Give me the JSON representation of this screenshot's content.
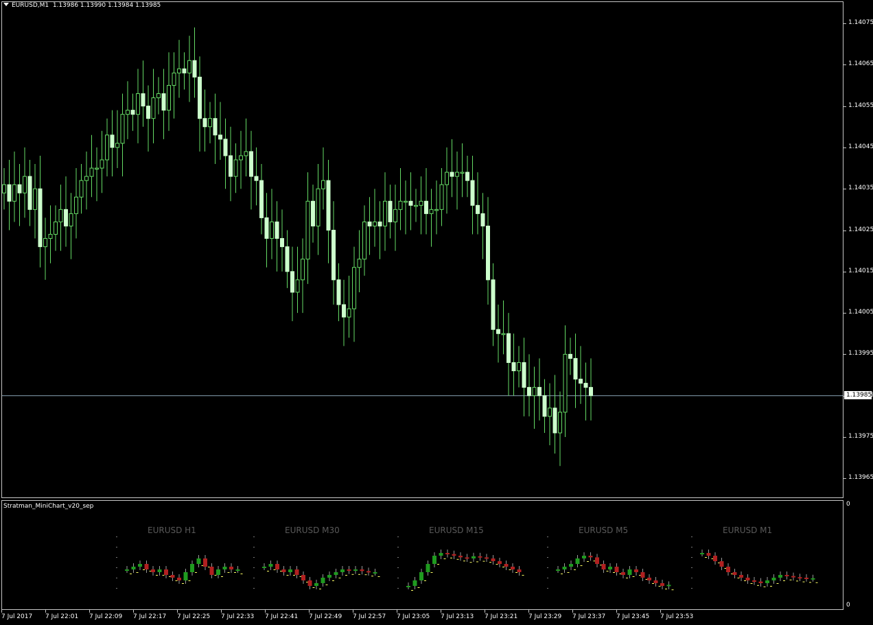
{
  "header": {
    "symbol_line": "EURUSD,M1  1.13986 1.13990 1.13984 1.13985"
  },
  "price_axis": {
    "labels": [
      "1.14075",
      "1.14065",
      "1.14055",
      "1.14045",
      "1.14035",
      "1.14025",
      "1.14015",
      "1.14005",
      "1.13995",
      "1.13985",
      "1.13975",
      "1.13965"
    ],
    "current": "1.13985"
  },
  "indicator": {
    "name": "Stratman_MiniChart_v20_sep",
    "scale_top": "0",
    "scale_bottom": "0",
    "mini_charts": [
      "EURUSD H1",
      "EURUSD M30",
      "EURUSD M15",
      "EURUSD M5",
      "EURUSD M1"
    ]
  },
  "time_axis": {
    "labels": [
      "7 Jul 2017",
      "7 Jul 22:01",
      "7 Jul 22:09",
      "7 Jul 22:17",
      "7 Jul 22:25",
      "7 Jul 22:33",
      "7 Jul 22:41",
      "7 Jul 22:49",
      "7 Jul 22:57",
      "7 Jul 23:05",
      "7 Jul 23:13",
      "7 Jul 23:21",
      "7 Jul 23:29",
      "7 Jul 23:37",
      "7 Jul 23:45",
      "7 Jul 23:53"
    ]
  },
  "colors": {
    "bull": "#000000",
    "bear": "#ccffcc",
    "wick": "#66dd66",
    "mini_bull": "#1f9a1f",
    "mini_bear": "#b02020",
    "price_line": "#8ba6b8"
  },
  "chart_data": {
    "type": "candlestick",
    "symbol": "EURUSD",
    "timeframe": "M1",
    "ylim": [
      1.1396,
      1.1408
    ],
    "current_price": 1.13985,
    "closes": [
      1.14036,
      1.14032,
      1.14036,
      1.14034,
      1.14038,
      1.1403,
      1.14035,
      1.14021,
      1.14023,
      1.14024,
      1.14027,
      1.1403,
      1.14026,
      1.14029,
      1.14033,
      1.14037,
      1.14038,
      1.1404,
      1.1404,
      1.14042,
      1.14048,
      1.14045,
      1.14046,
      1.14053,
      1.14054,
      1.14053,
      1.14058,
      1.14055,
      1.14052,
      1.14057,
      1.14058,
      1.14054,
      1.1406,
      1.14063,
      1.14064,
      1.14063,
      1.14066,
      1.14062,
      1.14052,
      1.1405,
      1.14052,
      1.14048,
      1.14047,
      1.14043,
      1.14038,
      1.14042,
      1.14043,
      1.14044,
      1.14038,
      1.14037,
      1.14028,
      1.14023,
      1.14027,
      1.14023,
      1.14021,
      1.14015,
      1.1401,
      1.14013,
      1.14018,
      1.14032,
      1.14026,
      1.14035,
      1.14037,
      1.14025,
      1.14013,
      1.14007,
      1.14004,
      1.14006,
      1.14016,
      1.14018,
      1.14027,
      1.14026,
      1.14027,
      1.14026,
      1.14032,
      1.14027,
      1.1403,
      1.14032,
      1.14032,
      1.14031,
      1.14031,
      1.14032,
      1.14029,
      1.1403,
      1.1403,
      1.14036,
      1.14039,
      1.14038,
      1.14039,
      1.14039,
      1.14037,
      1.14031,
      1.14029,
      1.14026,
      1.14013,
      1.14001,
      1.14,
      1.14,
      1.13993,
      1.13991,
      1.13993,
      1.13987,
      1.13985,
      1.13987,
      1.13985,
      1.1398,
      1.13982,
      1.13976,
      1.13981,
      1.13995,
      1.13994,
      1.13989,
      1.13988,
      1.13987,
      1.13985
    ]
  }
}
